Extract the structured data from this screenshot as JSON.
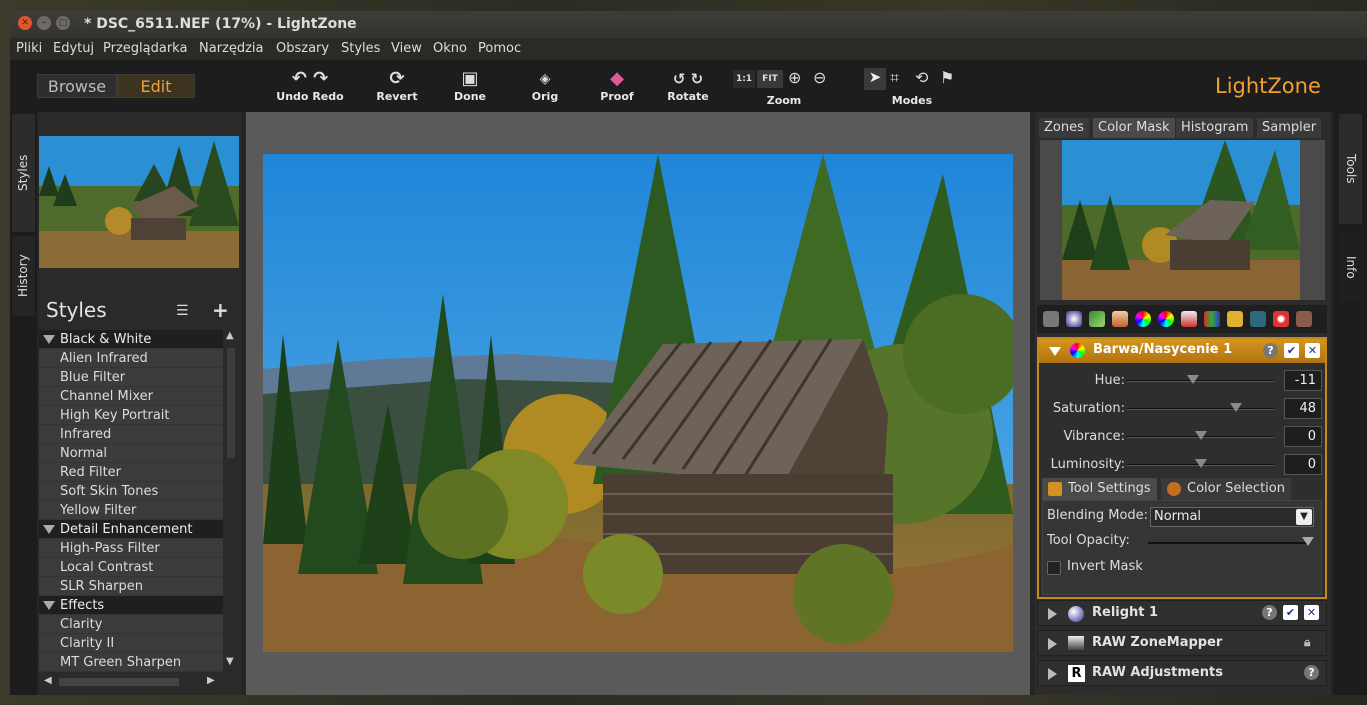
{
  "window": {
    "title": "* DSC_6511.NEF (17%) - LightZone"
  },
  "menu": [
    "Pliki",
    "Edytuj",
    "Przeglądarka",
    "Narzędzia",
    "Obszary",
    "Styles",
    "View",
    "Okno",
    "Pomoc"
  ],
  "mode_tabs": {
    "browse": "Browse",
    "edit": "Edit"
  },
  "toolbar": {
    "undo_redo": "Undo Redo",
    "revert": "Revert",
    "done": "Done",
    "orig": "Orig",
    "proof": "Proof",
    "rotate": "Rotate",
    "zoom": "Zoom",
    "zoom_1to1": "1:1",
    "zoom_fit": "FIT",
    "modes": "Modes"
  },
  "brand": {
    "logo": "LightZone",
    "color": "#f0a030"
  },
  "left_tabs": {
    "styles": "Styles",
    "history": "History"
  },
  "styles_panel": {
    "title": "Styles",
    "items": [
      {
        "label": "Black & White",
        "group": true
      },
      {
        "label": "Alien Infrared",
        "group": false
      },
      {
        "label": "Blue Filter",
        "group": false
      },
      {
        "label": "Channel Mixer",
        "group": false
      },
      {
        "label": "High Key Portrait",
        "group": false
      },
      {
        "label": "Infrared",
        "group": false
      },
      {
        "label": "Normal",
        "group": false
      },
      {
        "label": "Red Filter",
        "group": false
      },
      {
        "label": "Soft Skin Tones",
        "group": false
      },
      {
        "label": "Yellow Filter",
        "group": false
      },
      {
        "label": "Detail Enhancement",
        "group": true
      },
      {
        "label": "High-Pass Filter",
        "group": false
      },
      {
        "label": "Local Contrast",
        "group": false
      },
      {
        "label": "SLR Sharpen",
        "group": false
      },
      {
        "label": "Effects",
        "group": true
      },
      {
        "label": "Clarity",
        "group": false
      },
      {
        "label": "Clarity II",
        "group": false
      },
      {
        "label": "MT Green Sharpen",
        "group": false
      }
    ]
  },
  "right_tabs": {
    "zones": "Zones",
    "color_mask": "Color Mask",
    "histogram": "Histogram",
    "sampler": "Sampler"
  },
  "right_rail": {
    "tools": "Tools",
    "info": "Info"
  },
  "hue_tool": {
    "title": "Barwa/Nasycenie 1",
    "sliders": [
      {
        "label": "Hue:",
        "value": "-11",
        "level": 0.45
      },
      {
        "label": "Saturation:",
        "value": "48",
        "level": 0.74
      },
      {
        "label": "Vibrance:",
        "value": "0",
        "level": 0.5
      },
      {
        "label": "Luminosity:",
        "value": "0",
        "level": 0.5
      }
    ],
    "tab_tool_settings": "Tool Settings",
    "tab_color_selection": "Color Selection",
    "blending_label": "Blending Mode:",
    "blending_value": "Normal",
    "opacity_label": "Tool Opacity:",
    "opacity_level": 1.0,
    "invert_label": "Invert Mask"
  },
  "stack": [
    {
      "title": "Relight 1"
    },
    {
      "title": "RAW ZoneMapper"
    },
    {
      "title": "RAW Adjustments"
    }
  ],
  "colors": {
    "accent": "#c88a17",
    "edit_tab": "#4a3a1a"
  }
}
